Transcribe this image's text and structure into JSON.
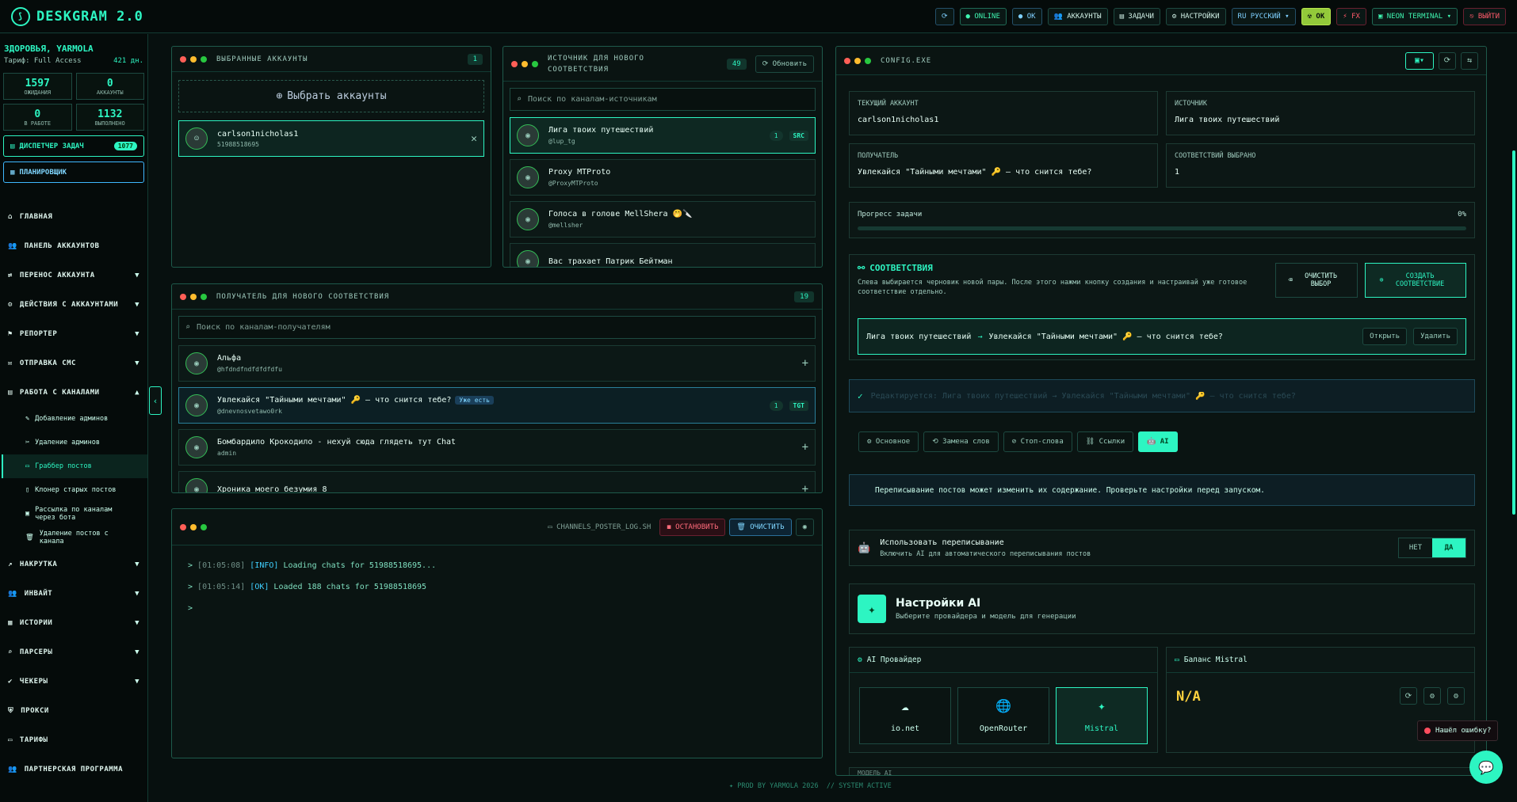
{
  "app": {
    "title": "DESKGRAM 2.0"
  },
  "topbar": [
    {
      "id": "refresh",
      "label": "⟳",
      "cls": "blue"
    },
    {
      "id": "online",
      "label": "● ONLINE",
      "cls": "green"
    },
    {
      "id": "ok",
      "label": "● OK",
      "cls": "blue"
    },
    {
      "id": "accounts",
      "label": "👥 АККАУНТЫ",
      "cls": ""
    },
    {
      "id": "tasks",
      "label": "▤ ЗАДАЧИ",
      "cls": ""
    },
    {
      "id": "settings",
      "label": "⚙ НАСТРОЙКИ",
      "cls": ""
    },
    {
      "id": "lang",
      "label": "RU РУССКИЙ ▾",
      "cls": "blue"
    },
    {
      "id": "ok2",
      "label": "☢ ОК",
      "cls": "yellow"
    },
    {
      "id": "fx",
      "label": "⚡ FX",
      "cls": "red"
    },
    {
      "id": "theme",
      "label": "▣ NEON TERMINAL ▾",
      "cls": "green"
    },
    {
      "id": "logout",
      "label": "⎋ ВЫЙТИ",
      "cls": "red"
    }
  ],
  "sidebar": {
    "user": "ЗДОРОВЬЯ, YARMOLA",
    "plan": "Тариф: Full Access",
    "days": "421 дн.",
    "stats": [
      {
        "v": "1597",
        "l": "ОЖИДАНИЯ"
      },
      {
        "v": "0",
        "l": "АККАУНТЫ"
      },
      {
        "v": "0",
        "l": "В РАБОТЕ"
      },
      {
        "v": "1132",
        "l": "ВЫПОЛНЕНО"
      }
    ],
    "dispatcher": "ДИСПЕТЧЕР ЗАДАЧ",
    "dispatcher_badge": "1077",
    "scheduler": "ПЛАНИРОВЩИК",
    "nav": [
      {
        "label": "ГЛАВНАЯ",
        "icon": "⌂",
        "chev": ""
      },
      {
        "label": "ПАНЕЛЬ АККАУНТОВ",
        "icon": "👥",
        "chev": ""
      },
      {
        "label": "ПЕРЕНОС АККАУНТА",
        "icon": "⇄",
        "chev": "▼"
      },
      {
        "label": "ДЕЙСТВИЯ С АККАУНТАМИ",
        "icon": "⚙",
        "chev": "▼"
      },
      {
        "label": "РЕПОРТЕР",
        "icon": "⚑",
        "chev": "▼"
      },
      {
        "label": "ОТПРАВКА СМС",
        "icon": "✉",
        "chev": "▼"
      },
      {
        "label": "РАБОТА С КАНАЛАМИ",
        "icon": "▤",
        "chev": "▲"
      }
    ],
    "sub": [
      {
        "label": "Добавление админов",
        "icon": "✎",
        "active": false
      },
      {
        "label": "Удаление админов",
        "icon": "✂",
        "active": false
      },
      {
        "label": "Граббер постов",
        "icon": "▭",
        "active": true
      },
      {
        "label": "Клонер старых постов",
        "icon": "▯",
        "active": false
      },
      {
        "label": "Рассылка по каналам через бота",
        "icon": "▣",
        "active": false
      },
      {
        "label": "Удаление постов с канала",
        "icon": "🗑",
        "active": false
      }
    ],
    "nav2": [
      {
        "label": "НАКРУТКА",
        "icon": "↗",
        "chev": "▼"
      },
      {
        "label": "ИНВАЙТ",
        "icon": "👥",
        "chev": "▼"
      },
      {
        "label": "ИСТОРИИ",
        "icon": "▦",
        "chev": "▼"
      },
      {
        "label": "ПАРСЕРЫ",
        "icon": "⌕",
        "chev": "▼"
      },
      {
        "label": "ЧЕКЕРЫ",
        "icon": "✔",
        "chev": "▼"
      },
      {
        "label": "ПРОКСИ",
        "icon": "⛨",
        "chev": ""
      },
      {
        "label": "ТАРИФЫ",
        "icon": "▭",
        "chev": ""
      },
      {
        "label": "ПАРТНЕРСКАЯ ПРОГРАММА",
        "icon": "👥",
        "chev": ""
      }
    ]
  },
  "accounts_panel": {
    "title": "ВЫБРАННЫЕ АККАУНТЫ",
    "count": "1",
    "choose": "Выбрать аккаунты",
    "account": {
      "name": "carlson1nicholas1",
      "phone": "51988518695"
    }
  },
  "source_panel": {
    "title": "ИСТОЧНИК ДЛЯ НОВОГО СООТВЕТСТВИЯ",
    "count": "49",
    "refresh": "⟳ Обновить",
    "search": "Поиск по каналам-источникам",
    "items": [
      {
        "name": "Лига твоих путешествий",
        "sub": "@lup_tg",
        "n": "1",
        "tag": "SRC",
        "sel": true
      },
      {
        "name": "Proxy MTProto",
        "sub": "@ProxyMTProto",
        "n": "",
        "tag": "",
        "sel": false
      },
      {
        "name": "Голоса в голове MellShera 🤭🔪",
        "sub": "@mellsher",
        "n": "",
        "tag": "",
        "sel": false
      },
      {
        "name": "Вас трахает Патрик Бейтман",
        "sub": "",
        "n": "",
        "tag": "",
        "sel": false
      }
    ]
  },
  "receiver_panel": {
    "title": "ПОЛУЧАТЕЛЬ ДЛЯ НОВОГО СООТВЕТСТВИЯ",
    "count": "19",
    "search": "Поиск по каналам-получателям",
    "items": [
      {
        "name": "Альфа",
        "sub": "@hfdndfndfdfdfdfu",
        "badge": "",
        "n": "",
        "tag": "",
        "sel": false
      },
      {
        "name": "Увлекайся \"Тайными мечтами\" 🔑 — что снится тебе?",
        "sub": "@dnevnosvetawo0rk",
        "badge": "Уже есть",
        "n": "1",
        "tag": "TGT",
        "sel": true
      },
      {
        "name": "Бомбардило Крокодило - нехуй сюда глядеть тут Chat",
        "sub": "admin",
        "badge": "",
        "n": "",
        "tag": "",
        "sel": false
      },
      {
        "name": "Хроника моего безумия 8",
        "sub": "",
        "badge": "",
        "n": "",
        "tag": "",
        "sel": false
      }
    ]
  },
  "log_panel": {
    "file": "▭ CHANNELS_POSTER_LOG.SH",
    "stop": "◼ ОСТАНОВИТЬ",
    "clear": "🗑 ОЧИСТИТЬ",
    "lines": [
      {
        "time": "[01:05:08]",
        "tag": "[INFO]",
        "msg": "Loading chats for 51988518695..."
      },
      {
        "time": "[01:05:14]",
        "tag": "[OK]",
        "msg": "Loaded 188 chats for 51988518695"
      }
    ],
    "prompt": ">"
  },
  "config": {
    "title": "CONFIG.EXE",
    "fields": [
      {
        "l": "ТЕКУЩИЙ АККАУНТ",
        "v": "carlson1nicholas1"
      },
      {
        "l": "ИСТОЧНИК",
        "v": "Лига твоих путешествий"
      },
      {
        "l": "ПОЛУЧАТЕЛЬ",
        "v": "Увлекайся \"Тайными мечтами\" 🔑 — что снится тебе?"
      },
      {
        "l": "СООТВЕТСТВИЙ ВЫБРАНО",
        "v": "1"
      }
    ],
    "progress_label": "Прогресс задачи",
    "progress_value": "0%",
    "progress": 0,
    "match_title": "СООТВЕТСТВИЯ",
    "match_desc": "Слева выбирается черновик новой пары. После этого нажми кнопку создания и настраивай уже готовое соответствие отдельно.",
    "clear_btn": "ОЧИСТИТЬ ВЫБОР",
    "create_btn": "СОЗДАТЬ СООТВЕТСТВИЕ",
    "pair_src": "Лига твоих путешествий",
    "pair_dst": "Увлекайся \"Тайными мечтами\" 🔑 — что снится тебе?",
    "open": "Открыть",
    "delete": "Удалить",
    "editing": "Редактируется: Лига твоих путешествий → Увлекайся \"Тайными мечтами\" 🔑 — что снится тебе?",
    "tabs": [
      {
        "label": "⚙ Основное",
        "active": false
      },
      {
        "label": "⟲ Замена слов",
        "active": false
      },
      {
        "label": "⊘ Стоп-слова",
        "active": false
      },
      {
        "label": "⛓ Ссылки",
        "active": false
      },
      {
        "label": "🤖 AI",
        "active": true
      }
    ],
    "warning": "Переписывание постов может изменить их содержание. Проверьте настройки перед запуском.",
    "rewrite_title": "Использовать переписывание",
    "rewrite_desc": "Включить AI для автоматического переписывания постов",
    "no": "НЕТ",
    "yes": "ДА",
    "ai_title": "Настройки AI",
    "ai_desc": "Выберите провайдера и модель для генерации",
    "provider_title": "AI Провайдер",
    "providers": [
      {
        "label": "io.net",
        "icon": "☁",
        "active": false
      },
      {
        "label": "OpenRouter",
        "icon": "🌐",
        "active": false
      },
      {
        "label": "Mistral",
        "icon": "✦",
        "active": true
      }
    ],
    "balance_title": "Баланс Mistral",
    "balance_value": "N/A",
    "model_title": "МОДЕЛЬ AI"
  },
  "footer": "✦ PROD BY YARMOLA 2026  // SYSTEM ACTIVE",
  "bug": "Нашёл ошибку?"
}
